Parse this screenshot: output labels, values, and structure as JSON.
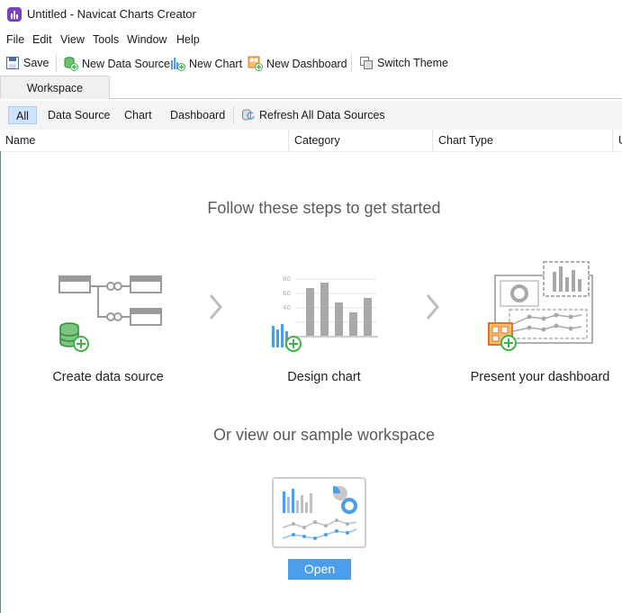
{
  "window": {
    "title": "Untitled - Navicat Charts Creator"
  },
  "menu": [
    "File",
    "Edit",
    "View",
    "Tools",
    "Window",
    "Help"
  ],
  "toolbar": {
    "save": "Save",
    "new_data_source": "New Data Source",
    "new_chart": "New Chart",
    "new_dashboard": "New Dashboard",
    "switch_theme": "Switch Theme"
  },
  "tabs": {
    "workspace": "Workspace"
  },
  "filters": {
    "all": "All",
    "data_source": "Data Source",
    "chart": "Chart",
    "dashboard": "Dashboard",
    "refresh": "Refresh All Data Sources"
  },
  "columns": [
    "Name",
    "Category",
    "Chart Type",
    "U"
  ],
  "main": {
    "heading": "Follow these steps to get started",
    "steps": [
      "Create data source",
      "Design chart",
      "Present your dashboard"
    ],
    "chart_ticks": [
      "80",
      "60",
      "40"
    ],
    "sample_heading": "Or view our sample workspace",
    "open_button": "Open"
  },
  "colors": {
    "accent": "#4a9eea",
    "green": "#3cb34a",
    "app_icon": "#7b3fbf",
    "orange": "#e0732a"
  }
}
